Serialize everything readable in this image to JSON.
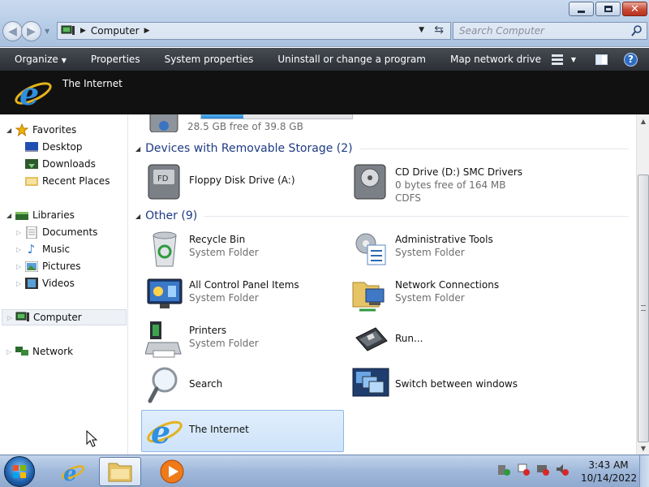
{
  "window": {
    "breadcrumb": [
      "Computer"
    ],
    "search_placeholder": "Search Computer",
    "buttons": {
      "minimize": "minimize",
      "maximize": "maximize",
      "close": "close"
    }
  },
  "toolbar": {
    "items": [
      "Organize",
      "Properties",
      "System properties",
      "Uninstall or change a program",
      "Map network drive"
    ]
  },
  "banner": {
    "title": "The Internet"
  },
  "nav": {
    "favorites": "Favorites",
    "desktop": "Desktop",
    "downloads": "Downloads",
    "recent": "Recent Places",
    "libraries": "Libraries",
    "documents": "Documents",
    "music": "Music",
    "pictures": "Pictures",
    "videos": "Videos",
    "computer": "Computer",
    "network": "Network"
  },
  "content": {
    "partial_drive": {
      "free": "28.5 GB free of 39.8 GB",
      "used_fraction": 0.28
    },
    "groups": {
      "removable": "Devices with Removable Storage (2)",
      "other": "Other (9)"
    },
    "removable_items": [
      {
        "name": "Floppy Disk Drive (A:)"
      },
      {
        "name": "CD Drive (D:) SMC Drivers",
        "sub": "0 bytes free of 164 MB",
        "sub2": "CDFS"
      }
    ],
    "other_items": [
      {
        "name": "Recycle Bin",
        "sub": "System Folder"
      },
      {
        "name": "Administrative Tools",
        "sub": "System Folder"
      },
      {
        "name": "All Control Panel Items",
        "sub": "System Folder"
      },
      {
        "name": "Network Connections",
        "sub": "System Folder"
      },
      {
        "name": "Printers",
        "sub": "System Folder"
      },
      {
        "name": "Run..."
      },
      {
        "name": "Search"
      },
      {
        "name": "Switch between windows"
      },
      {
        "name": "The Internet"
      }
    ]
  },
  "taskbar": {
    "time": "3:43 AM",
    "date": "10/14/2022"
  },
  "colors": {
    "group_header": "#1d3b83",
    "command_bar": "#2c3036",
    "selection": "#cde3fa"
  }
}
